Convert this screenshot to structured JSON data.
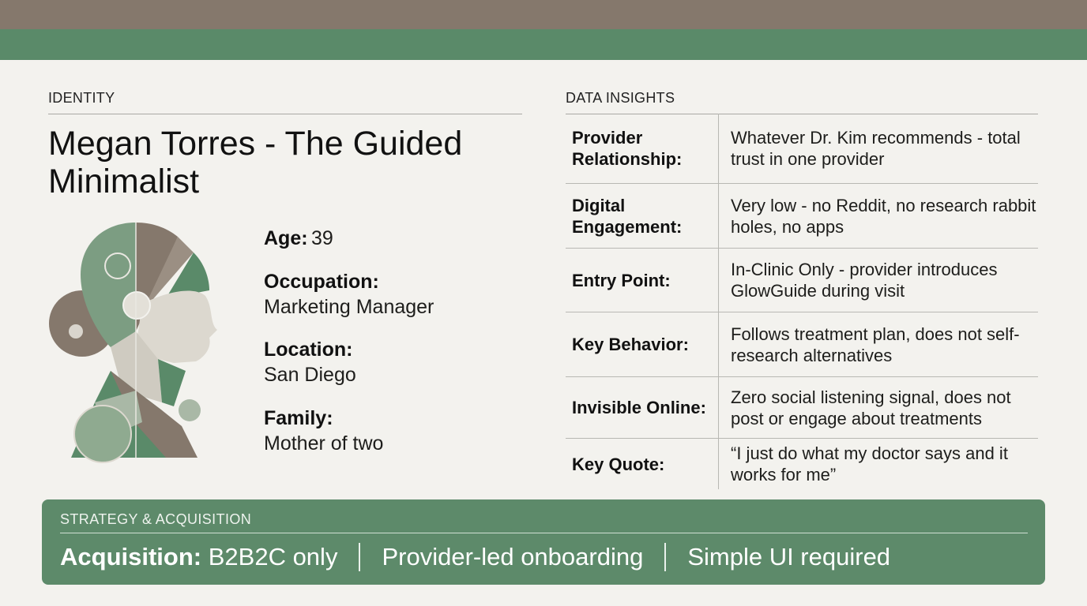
{
  "identity": {
    "section_label": "IDENTITY",
    "name": "Megan Torres - The Guided Minimalist",
    "attributes": [
      {
        "label": "Age:",
        "value": "39",
        "inline": true
      },
      {
        "label": "Occupation:",
        "value": "Marketing Manager",
        "inline": false
      },
      {
        "label": "Location:",
        "value": "San Diego",
        "inline": false
      },
      {
        "label": "Family:",
        "value": "Mother of two",
        "inline": false
      }
    ]
  },
  "insights": {
    "section_label": "DATA INSIGHTS",
    "rows": [
      {
        "key": "Provider Relationship:",
        "value": "Whatever Dr. Kim recommends - total trust in one provider"
      },
      {
        "key": "Digital Engagement:",
        "value": "Very low - no Reddit, no research rabbit holes, no apps"
      },
      {
        "key": "Entry Point:",
        "value": "In-Clinic Only - provider introduces GlowGuide during visit"
      },
      {
        "key": "Key Behavior:",
        "value": "Follows treatment plan, does not self-research alternatives"
      },
      {
        "key": "Invisible Online:",
        "value": "Zero social listening signal, does not post or engage about treatments"
      },
      {
        "key": "Key Quote:",
        "value": "“I just do what my doctor says and it works for me”"
      }
    ]
  },
  "strategy": {
    "section_label": "STRATEGY & ACQUISITION",
    "acquisition_label": "Acquisition:",
    "acquisition_value": "B2B2C only",
    "item_2": "Provider-led onboarding",
    "item_3": "Simple UI required"
  },
  "colors": {
    "header_brown": "#85786c",
    "accent_green": "#5a8a69",
    "background": "#f3f2ee"
  }
}
